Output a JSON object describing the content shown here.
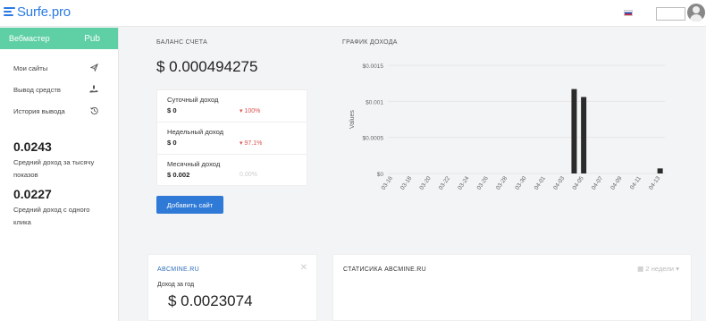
{
  "header": {
    "logo_text": "Surfe.pro",
    "brand_color": "#2a7ae2",
    "flag_icon": "russian-flag-icon",
    "avatar_icon": "user-avatar-icon"
  },
  "sidebar": {
    "header_left": "Вебмастер",
    "header_right": "Pub",
    "accent": "#5fd0a6",
    "items": [
      {
        "label": "Мои сайты",
        "icon": "paper-plane-icon"
      },
      {
        "label": "Вывод средств",
        "icon": "withdraw-hand-icon"
      },
      {
        "label": "История вывода",
        "icon": "history-icon"
      }
    ],
    "stat1_value": "0.0243",
    "stat1_desc": "Средний доход за тысячу показов",
    "stat2_value": "0.0227",
    "stat2_desc": "Средний доход с одного клика"
  },
  "balance": {
    "label": "БАЛАНС СЧЕТА",
    "value": "$ 0.000494275",
    "rows": [
      {
        "name": "Суточный доход",
        "value": "$ 0",
        "change": "100%",
        "trend": "down"
      },
      {
        "name": "Недельный доход",
        "value": "$ 0",
        "change": "97.1%",
        "trend": "down"
      },
      {
        "name": "Месячный доход",
        "value": "$ 0.002",
        "change": "0.00%",
        "trend": "none"
      }
    ],
    "add_button": "Добавить сайт",
    "button_color": "#2f7ad6"
  },
  "income_chart": {
    "label": "ГРАФИК ДОХОДА"
  },
  "chart_data": {
    "type": "bar",
    "ylabel": "Values",
    "ylim": [
      0,
      0.0015
    ],
    "yticks": [
      "$0",
      "$0.0005",
      "$0.001",
      "$0.0015"
    ],
    "ytick_values": [
      0,
      0.0005,
      0.001,
      0.0015
    ],
    "categories": [
      "03-16",
      "03-17",
      "03-18",
      "03-19",
      "03-20",
      "03-21",
      "03-22",
      "03-23",
      "03-24",
      "03-25",
      "03-26",
      "03-27",
      "03-28",
      "03-29",
      "03-30",
      "03-31",
      "04-01",
      "04-02",
      "04-03",
      "04-04",
      "04-05",
      "04-06",
      "04-07",
      "04-08",
      "04-09",
      "04-10",
      "04-11",
      "04-12",
      "04-13"
    ],
    "xtick_labels": [
      "03-16",
      "03-18",
      "03-20",
      "03-22",
      "03-24",
      "03-26",
      "03-28",
      "03-30",
      "04-01",
      "04-03",
      "04-05",
      "04-07",
      "04-09",
      "04-11",
      "04-13"
    ],
    "values": [
      0,
      0,
      0,
      0,
      0,
      0,
      0,
      0,
      0,
      0,
      0,
      0,
      0,
      0,
      0,
      0,
      0,
      0,
      0,
      0.00117,
      0.00106,
      0,
      0,
      0,
      0,
      0,
      0,
      0,
      7e-05
    ],
    "bar_color": "#2b2b2b",
    "grid": true
  },
  "site_card": {
    "title": "ABCMINE.RU",
    "close_icon": "close-icon",
    "sub": "Доход за год",
    "value": "$ 0.0023074"
  },
  "stats_card": {
    "title": "СТАТИСИКА ABCMINE.RU",
    "period_icon": "calendar-icon",
    "period": "2 недели"
  }
}
